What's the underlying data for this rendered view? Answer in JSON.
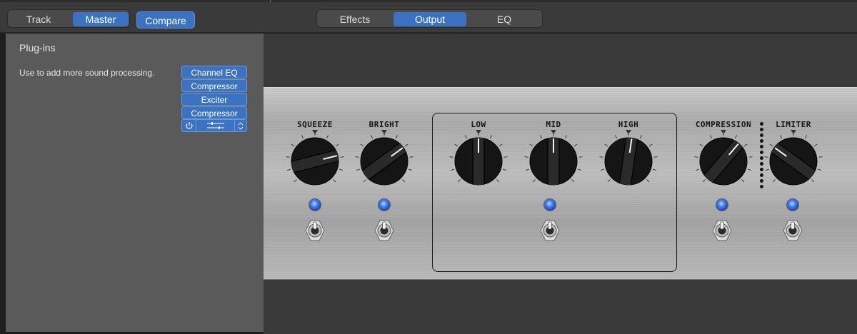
{
  "topbar": {
    "left_tabs": [
      {
        "label": "Track",
        "active": false
      },
      {
        "label": "Master",
        "active": true
      }
    ],
    "compare_label": "Compare",
    "view_tabs": [
      {
        "label": "Effects",
        "active": false
      },
      {
        "label": "Output",
        "active": true
      },
      {
        "label": "EQ",
        "active": false
      }
    ]
  },
  "plugins": {
    "title": "Plug-ins",
    "description": "Use to add more sound processing.",
    "slots": [
      "Channel EQ",
      "Compressor",
      "Exciter",
      "Compressor"
    ],
    "controls": {
      "power_icon": "power-icon",
      "settings_icon": "sliders-icon",
      "menu_icon": "up-down-chevron-icon"
    }
  },
  "amp": {
    "knobs": [
      {
        "label": "SQUEEZE",
        "value": 0.78
      },
      {
        "label": "BRIGHT",
        "value": 0.7
      },
      {
        "label": "LOW",
        "value": 0.5
      },
      {
        "label": "MID",
        "value": 0.5
      },
      {
        "label": "HIGH",
        "value": 0.53
      },
      {
        "label": "COMPRESSION",
        "value": 0.65
      },
      {
        "label": "LIMITER",
        "value": 0.3
      }
    ],
    "led_color": "#3f7ff0",
    "panel_color": "#b5b5b5"
  }
}
